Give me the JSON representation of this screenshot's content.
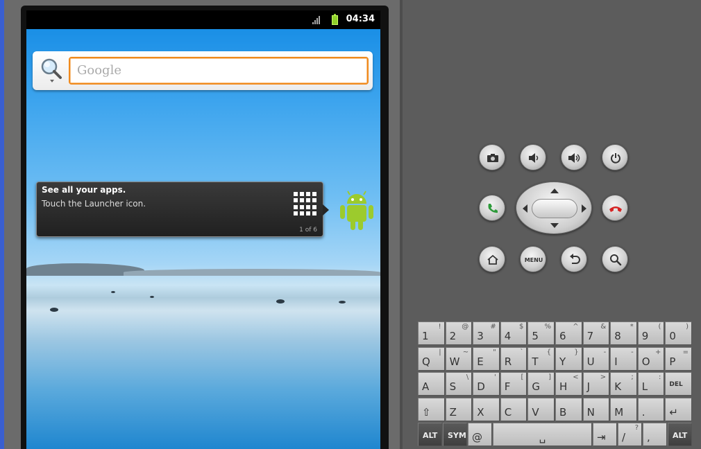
{
  "status_bar": {
    "clock": "04:34",
    "icons": [
      "signal-icon",
      "battery-charging-icon"
    ]
  },
  "search": {
    "placeholder": "Google",
    "icon": "magnifier-icon"
  },
  "launcher_tip": {
    "title": "See all your apps.",
    "body": "Touch the Launcher icon.",
    "counter": "1 of 6"
  },
  "controls": {
    "row1": [
      "camera-icon",
      "volume-down-icon",
      "volume-up-icon",
      "power-icon"
    ],
    "row2": [
      "call-icon",
      "dpad",
      "end-call-icon"
    ],
    "row3": [
      "home-icon",
      "menu-button",
      "back-icon",
      "search-icon"
    ],
    "menu_label": "MENU",
    "colors": {
      "call": "#2d9a3a",
      "end_call": "#d62424"
    }
  },
  "keyboard": {
    "rows": [
      [
        {
          "main": "1",
          "alt": "!"
        },
        {
          "main": "2",
          "alt": "@"
        },
        {
          "main": "3",
          "alt": "#"
        },
        {
          "main": "4",
          "alt": "$"
        },
        {
          "main": "5",
          "alt": "%"
        },
        {
          "main": "6",
          "alt": "^"
        },
        {
          "main": "7",
          "alt": "&"
        },
        {
          "main": "8",
          "alt": "*"
        },
        {
          "main": "9",
          "alt": "("
        },
        {
          "main": "0",
          "alt": ")"
        }
      ],
      [
        {
          "main": "Q",
          "alt": "|"
        },
        {
          "main": "W",
          "alt": "~"
        },
        {
          "main": "E",
          "alt": "\""
        },
        {
          "main": "R",
          "alt": "`"
        },
        {
          "main": "T",
          "alt": "{"
        },
        {
          "main": "Y",
          "alt": "}"
        },
        {
          "main": "U",
          "alt": "-"
        },
        {
          "main": "I",
          "alt": "-"
        },
        {
          "main": "O",
          "alt": "+"
        },
        {
          "main": "P",
          "alt": "="
        }
      ],
      [
        {
          "main": "A",
          "alt": ""
        },
        {
          "main": "S",
          "alt": "\\"
        },
        {
          "main": "D",
          "alt": "'"
        },
        {
          "main": "F",
          "alt": "["
        },
        {
          "main": "G",
          "alt": "]"
        },
        {
          "main": "H",
          "alt": "<"
        },
        {
          "main": "J",
          "alt": ">"
        },
        {
          "main": "K",
          "alt": ";"
        },
        {
          "main": "L",
          "alt": ":"
        },
        {
          "main": "DEL",
          "alt": ""
        }
      ],
      [
        {
          "main": "⇧",
          "alt": ""
        },
        {
          "main": "Z",
          "alt": ""
        },
        {
          "main": "X",
          "alt": ""
        },
        {
          "main": "C",
          "alt": ""
        },
        {
          "main": "V",
          "alt": ""
        },
        {
          "main": "B",
          "alt": ""
        },
        {
          "main": "N",
          "alt": ""
        },
        {
          "main": "M",
          "alt": ""
        },
        {
          "main": ".",
          "alt": ""
        },
        {
          "main": "↵",
          "alt": ""
        }
      ]
    ],
    "bottom_row": {
      "alt_left": "ALT",
      "sym": "SYM",
      "at": "@",
      "space": "␣",
      "tab": "⇥",
      "slash": "/",
      "slash_alt": "?",
      "comma": ",",
      "alt_right": "ALT"
    }
  }
}
